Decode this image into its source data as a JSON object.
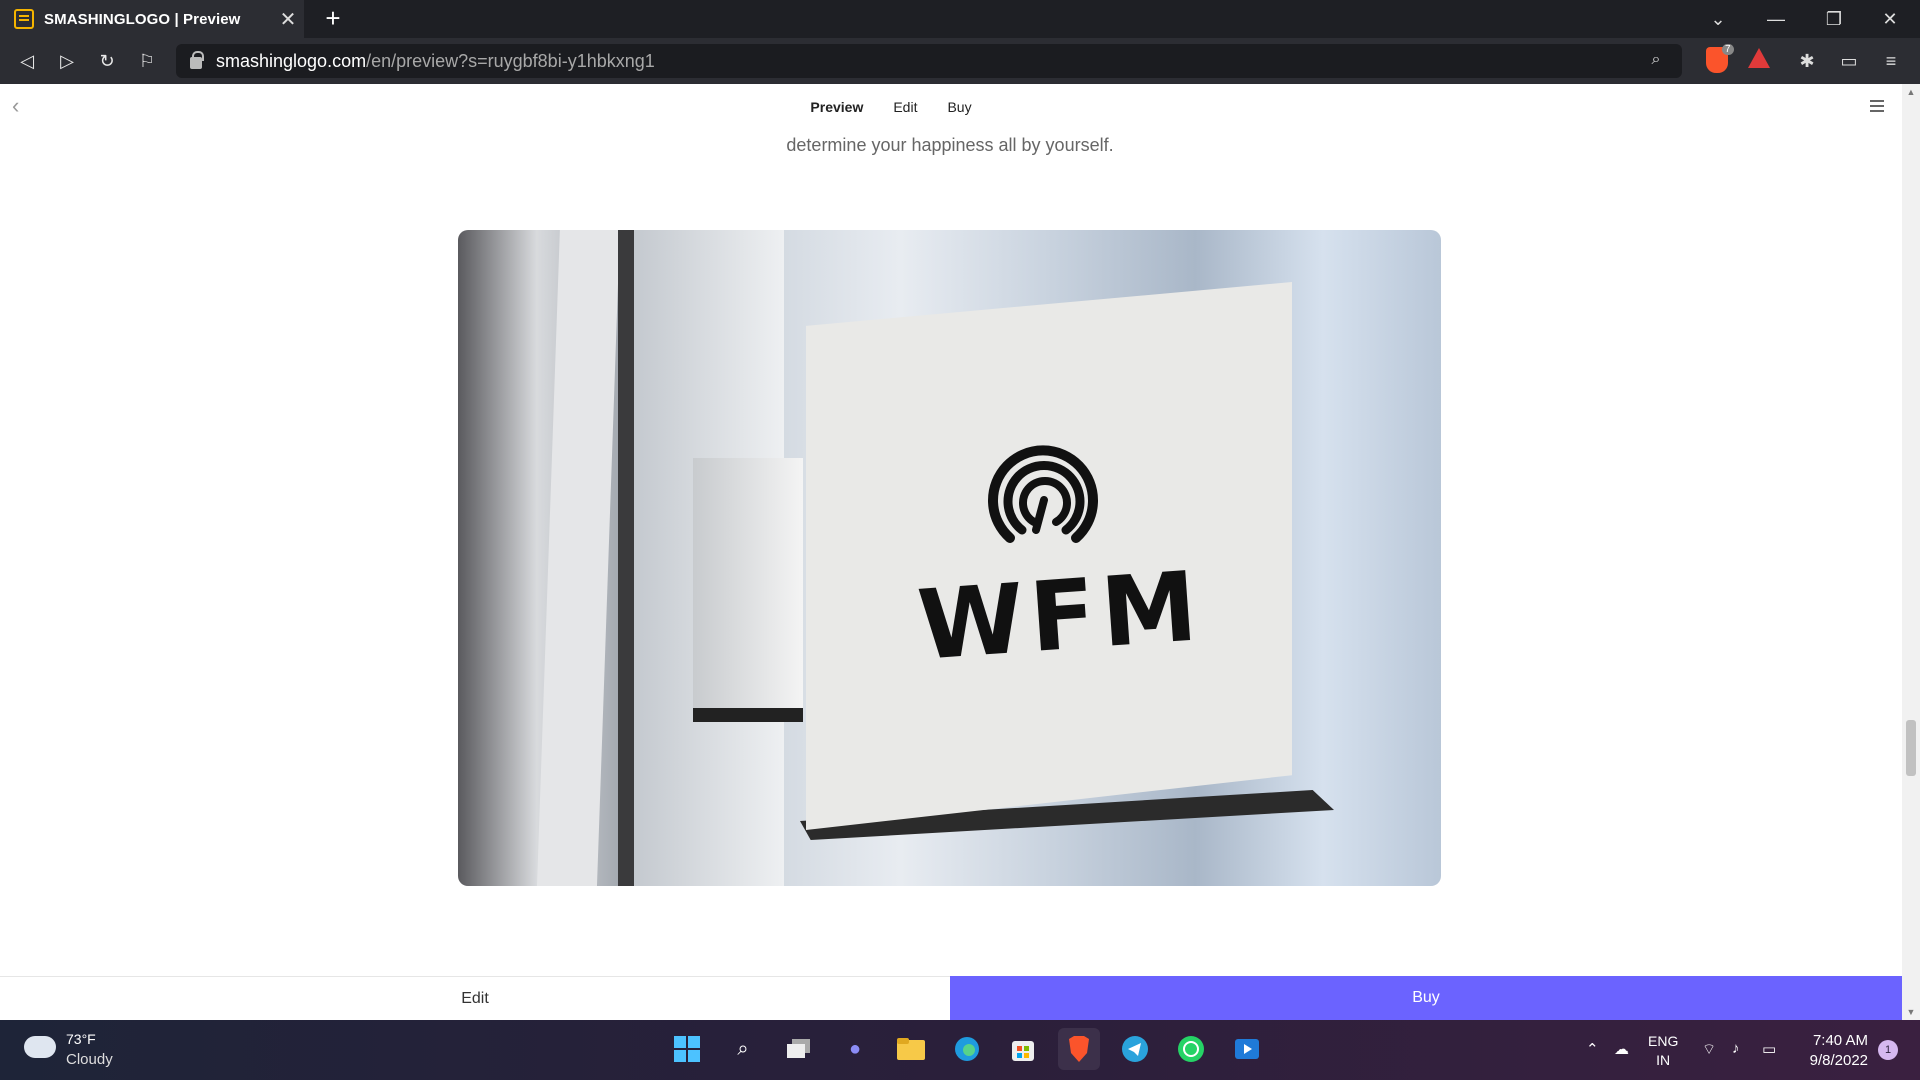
{
  "browser": {
    "tab_title": "SMASHINGLOGO | Preview",
    "tab_close": "✕",
    "new_tab": "+",
    "url_host": "smashinglogo.com",
    "url_path": "/en/preview?s=ruygbf8bi-y1hbkxng1",
    "brave_badge": "7"
  },
  "site": {
    "nav": {
      "preview": "Preview",
      "edit": "Edit",
      "buy": "Buy"
    },
    "paragraph": "employment. The beauty of entrepreneurship is that you make your own decisions every day and determine your happiness all by yourself.",
    "logo_text": "WFM",
    "bottom": {
      "edit": "Edit",
      "buy": "Buy"
    },
    "accent_color": "#6b63ff"
  },
  "taskbar": {
    "weather_temp": "73°F",
    "weather_cond": "Cloudy",
    "lang_1": "ENG",
    "lang_2": "IN",
    "time": "7:40 AM",
    "date": "9/8/2022",
    "notification_count": "1",
    "apps": [
      "start-icon",
      "search-icon",
      "task-view-icon",
      "chat-icon",
      "file-explorer-icon",
      "edge-icon",
      "store-icon",
      "brave-icon",
      "telegram-icon",
      "whatsapp-icon",
      "media-player-icon"
    ]
  }
}
